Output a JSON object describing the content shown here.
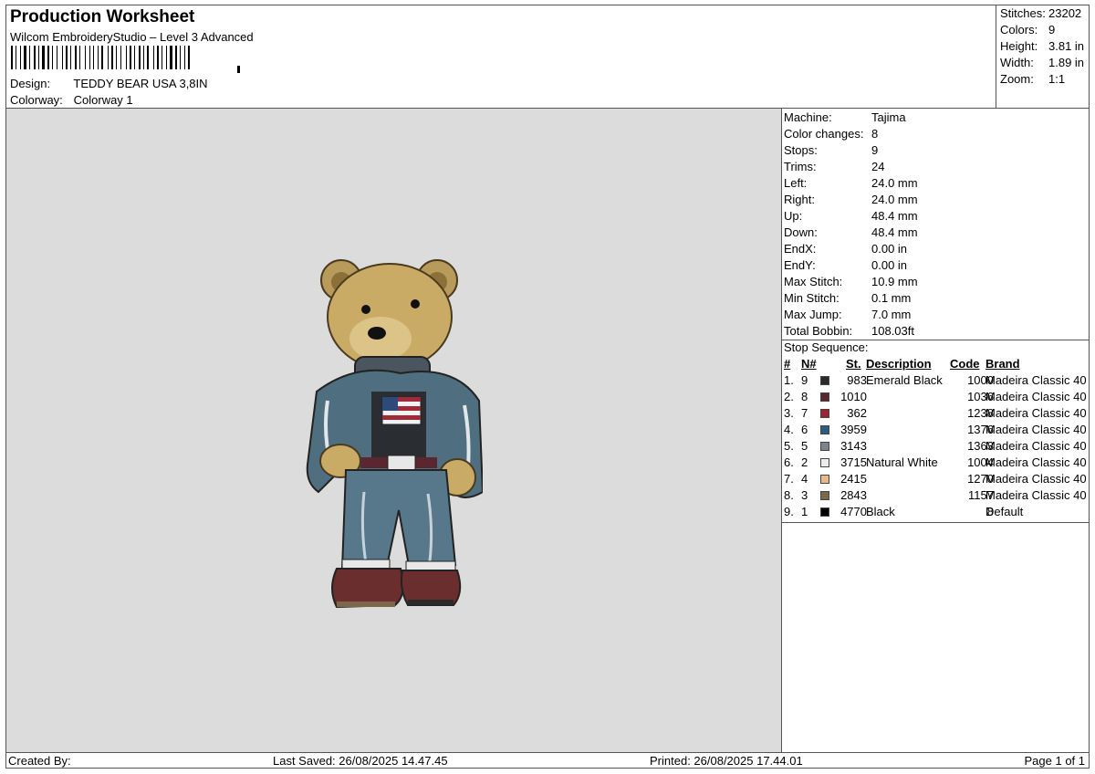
{
  "header": {
    "title": "Production Worksheet",
    "subtitle": "Wilcom EmbroideryStudio – Level 3 Advanced",
    "design_label": "Design:",
    "design_value": "TEDDY BEAR USA 3,8IN",
    "colorway_label": "Colorway:",
    "colorway_value": "Colorway 1"
  },
  "summary": {
    "stitches_label": "Stitches:",
    "stitches_value": "23202",
    "colors_label": "Colors:",
    "colors_value": "9",
    "height_label": "Height:",
    "height_value": "3.81 in",
    "width_label": "Width:",
    "width_value": "1.89 in",
    "zoom_label": "Zoom:",
    "zoom_value": "1:1"
  },
  "machine": [
    {
      "label": "Machine:",
      "value": "Tajima"
    },
    {
      "label": "Color changes:",
      "value": "8"
    },
    {
      "label": "Stops:",
      "value": "9"
    },
    {
      "label": "Trims:",
      "value": "24"
    },
    {
      "label": "Left:",
      "value": "24.0 mm"
    },
    {
      "label": "Right:",
      "value": "24.0 mm"
    },
    {
      "label": "Up:",
      "value": "48.4 mm"
    },
    {
      "label": "Down:",
      "value": "48.4 mm"
    },
    {
      "label": "EndX:",
      "value": "0.00 in"
    },
    {
      "label": "EndY:",
      "value": "0.00 in"
    },
    {
      "label": "Max Stitch:",
      "value": "10.9 mm"
    },
    {
      "label": "Min Stitch:",
      "value": "0.1 mm"
    },
    {
      "label": "Max Jump:",
      "value": "7.0 mm"
    },
    {
      "label": "Total Bobbin:",
      "value": "108.03ft"
    }
  ],
  "stop_sequence": {
    "title": "Stop Sequence:",
    "headers": {
      "num": "#",
      "n": "N#",
      "st": "St.",
      "desc": "Description",
      "code": "Code",
      "brand": "Brand"
    },
    "rows": [
      {
        "num": "1.",
        "n": "9",
        "color": "#2a2a2a",
        "st": "983",
        "desc": "Emerald Black",
        "code": "1000",
        "brand": "Madeira Classic 40"
      },
      {
        "num": "2.",
        "n": "8",
        "color": "#5a2630",
        "st": "1010",
        "desc": "",
        "code": "1036",
        "brand": "Madeira Classic 40"
      },
      {
        "num": "3.",
        "n": "7",
        "color": "#9b2432",
        "st": "362",
        "desc": "",
        "code": "1238",
        "brand": "Madeira Classic 40"
      },
      {
        "num": "4.",
        "n": "6",
        "color": "#2c5c7e",
        "st": "3959",
        "desc": "",
        "code": "1376",
        "brand": "Madeira Classic 40"
      },
      {
        "num": "5.",
        "n": "5",
        "color": "#7b8391",
        "st": "3143",
        "desc": "",
        "code": "1363",
        "brand": "Madeira Classic 40"
      },
      {
        "num": "6.",
        "n": "2",
        "color": "#ececec",
        "st": "3715",
        "desc": "Natural White",
        "code": "1004",
        "brand": "Madeira Classic 40"
      },
      {
        "num": "7.",
        "n": "4",
        "color": "#e5b98a",
        "st": "2415",
        "desc": "",
        "code": "1270",
        "brand": "Madeira Classic 40"
      },
      {
        "num": "8.",
        "n": "3",
        "color": "#7a6848",
        "st": "2843",
        "desc": "",
        "code": "1157",
        "brand": "Madeira Classic 40"
      },
      {
        "num": "9.",
        "n": "1",
        "color": "#000000",
        "st": "4770",
        "desc": "Black",
        "code": "8",
        "brand": "Default"
      }
    ]
  },
  "footer": {
    "created": "Created By:",
    "saved": "Last Saved: 26/08/2025 14.47.45",
    "printed": "Printed: 26/08/2025 17.44.01",
    "page": "Page 1 of 1"
  }
}
